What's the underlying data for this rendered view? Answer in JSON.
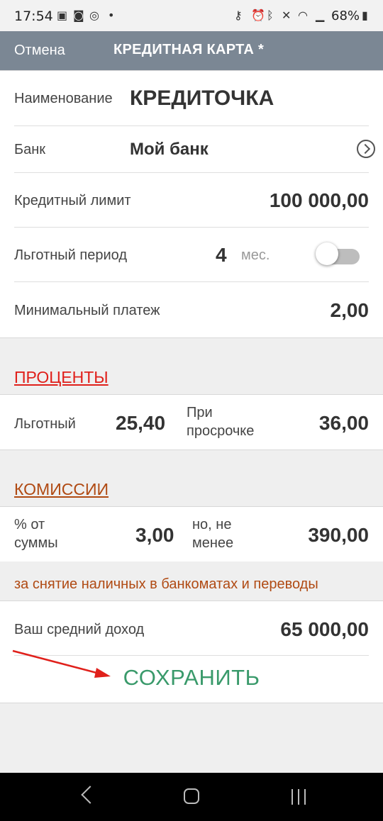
{
  "status_bar": {
    "time": "17:54",
    "left_icons": [
      "image-icon",
      "camera-icon",
      "sync-icon",
      "dot-icon"
    ],
    "right_icons": [
      "key-icon",
      "alarm-icon",
      "bluetooth-icon",
      "mute-icon",
      "wifi-icon",
      "signal-icon"
    ],
    "battery": "68%"
  },
  "toolbar": {
    "cancel_label": "Отмена",
    "title": "КРЕДИТНАЯ КАРТА *"
  },
  "form": {
    "name": {
      "label": "Наименование",
      "value": "КРЕДИТОЧКА"
    },
    "bank": {
      "label": "Банк",
      "value": "Мой банк"
    },
    "limit": {
      "label": "Кредитный лимит",
      "value": "100 000,00"
    },
    "grace": {
      "label": "Льготный период",
      "value": "4",
      "unit": "мес.",
      "toggle_on": false
    },
    "min_payment": {
      "label": "Минимальный платеж",
      "value": "2,00"
    }
  },
  "interest": {
    "title": "ПРОЦЕНТЫ",
    "grace_label": "Льготный",
    "grace_value": "25,40",
    "overdue_label_1": "При",
    "overdue_label_2": "просрочке",
    "overdue_value": "36,00"
  },
  "fees": {
    "title": "КОМИССИИ",
    "pct_label_1": "% от",
    "pct_label_2": "суммы",
    "pct_value": "3,00",
    "min_label_1": "но, не",
    "min_label_2": "менее",
    "min_value": "390,00",
    "note": "за снятие наличных в банкоматах и переводы"
  },
  "income": {
    "label": "Ваш средний доход",
    "value": "65 000,00"
  },
  "actions": {
    "save_label": "СОХРАНИТЬ"
  },
  "colors": {
    "toolbar": "#7b8794",
    "interest_title": "#e0201b",
    "fees_title": "#b04a13",
    "save": "#3a9a6b",
    "arrow": "#e0201b"
  }
}
